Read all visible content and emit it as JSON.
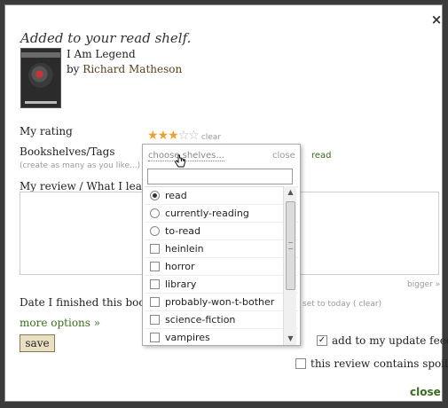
{
  "modal": {
    "heading": "Added to your read shelf.",
    "close_x": "×",
    "close_label": "close"
  },
  "book": {
    "title": "I Am Legend",
    "by_prefix": "by",
    "author": "Richard Matheson"
  },
  "rating": {
    "label": "My rating",
    "value": 3,
    "max": 5,
    "star_on": "★",
    "star_off": "☆",
    "clear_label": "clear"
  },
  "shelves": {
    "label": "Bookshelves/Tags",
    "hint": "(create as many as you like...)",
    "current": "read"
  },
  "review": {
    "label": "My review / What I learne",
    "bigger_label": "bigger »"
  },
  "date": {
    "label": "Date I finished this book",
    "set_today": "set to today",
    "clear": "( clear)"
  },
  "more_options": "more options »",
  "save_label": "save",
  "update_feed": {
    "label": "add to my update feed",
    "checked": true,
    "help": "?"
  },
  "spoilers": {
    "label": "this review contains spoilers",
    "checked": false
  },
  "dropdown": {
    "choose_label": "choose shelves...",
    "close_label": "close",
    "input_value": "",
    "items": [
      {
        "label": "read",
        "kind": "radio",
        "selected": true
      },
      {
        "label": "currently-reading",
        "kind": "radio",
        "selected": false
      },
      {
        "label": "to-read",
        "kind": "radio",
        "selected": false
      },
      {
        "label": "heinlein",
        "kind": "checkbox",
        "selected": false
      },
      {
        "label": "horror",
        "kind": "checkbox",
        "selected": false
      },
      {
        "label": "library",
        "kind": "checkbox",
        "selected": false
      },
      {
        "label": "probably-won-t-bother",
        "kind": "checkbox",
        "selected": false
      },
      {
        "label": "science-fiction",
        "kind": "checkbox",
        "selected": false
      },
      {
        "label": "vampires",
        "kind": "checkbox",
        "selected": false
      }
    ],
    "scroll_up": "▲",
    "scroll_down": "▼"
  }
}
